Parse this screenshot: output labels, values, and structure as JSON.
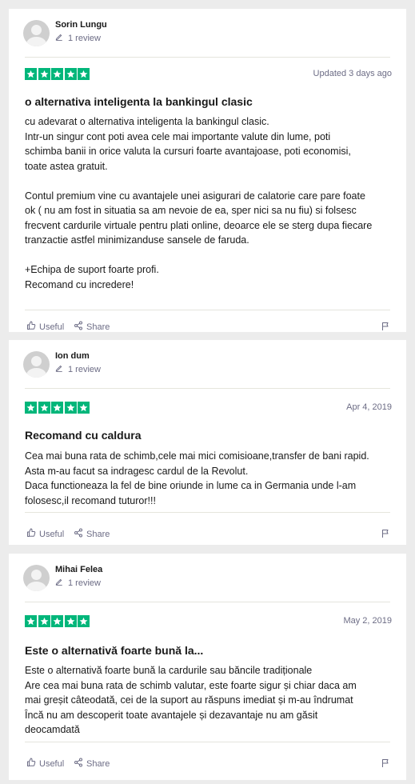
{
  "reviews": [
    {
      "author": "Sorin Lungu",
      "review_count": "1 review",
      "rating": 5,
      "date": "Updated 3 days ago",
      "title": "o alternativa inteligenta la bankingul clasic",
      "body": [
        "cu adevarat o alternativa inteligenta la bankingul clasic.",
        "Intr-un singur cont poti avea cele mai importante valute din lume, poti",
        "schimba banii in orice valuta la cursuri foarte avantajoase, poti economisi,",
        "toate astea gratuit.",
        "",
        "Contul premium vine cu avantajele unei asigurari de calatorie care pare foate",
        "ok ( nu am fost in situatia sa am nevoie de ea, sper nici sa nu fiu) si folsesc",
        "frecvent cardurile virtuale pentru plati online, deoarce ele se sterg dupa fiecare",
        "tranzactie astfel minimizanduse sansele de faruda.",
        "",
        "+Echipa de suport foarte profi.",
        "Recomand cu incredere!"
      ],
      "useful_label": "Useful",
      "share_label": "Share"
    },
    {
      "author": "Ion dum",
      "review_count": "1 review",
      "rating": 5,
      "date": "Apr 4, 2019",
      "title": "Recomand cu caldura",
      "body": [
        "Cea mai buna rata de schimb,cele mai mici comisioane,transfer de bani rapid.",
        "Asta m-au facut sa indragesc cardul de la Revolut.",
        "Daca functioneaza la fel de bine oriunde in lume ca in Germania unde l-am",
        "folosesc,il recomand tuturor!!!"
      ],
      "useful_label": "Useful",
      "share_label": "Share"
    },
    {
      "author": "Mihai Felea",
      "review_count": "1 review",
      "rating": 5,
      "date": "May 2, 2019",
      "title": "Este o alternativă foarte bună la...",
      "body": [
        "Este o alternativă foarte bună la cardurile sau băncile tradiționale",
        "Are cea mai buna rata de schimb valutar, este foarte sigur și chiar daca am",
        "mai greșit câteodată, cei de la suport au răspuns imediat și m-au îndrumat",
        "Încă nu am descoperit toate avantajele și dezavantaje nu am găsit",
        "deocamdată"
      ],
      "useful_label": "Useful",
      "share_label": "Share"
    }
  ],
  "colors": {
    "star_green": "#00b67a",
    "muted_text": "#6c6c85",
    "page_bg": "#ececec"
  },
  "icons": [
    "avatar-placeholder-icon",
    "pencil-icon",
    "star-icon",
    "thumbs-up-icon",
    "share-icon",
    "flag-icon"
  ]
}
